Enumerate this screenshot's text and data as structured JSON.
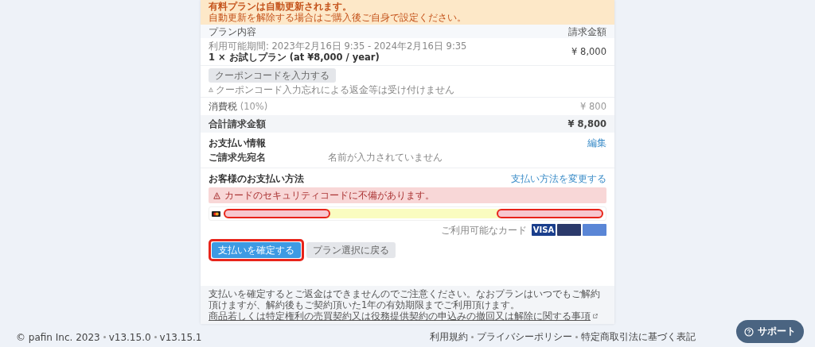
{
  "notice": {
    "title": "有料プランは自動更新されます。",
    "text": "自動更新を解除する場合はご購入後ご自身で設定ください。"
  },
  "plan_table": {
    "columns": [
      "プラン内容",
      "請求金額"
    ],
    "item": {
      "period": "利用可能期間: 2023年2月16日 9:35 - 2024年2月16日 9:35",
      "name": "1 × お試しプラン (at ¥8,000 / year)",
      "amount": "¥ 8,000"
    },
    "coupon_button": "クーポンコードを入力する",
    "coupon_note": "クーポンコード入力忘れによる返金等は受け付けません",
    "tax": {
      "label": "消費税",
      "rate": "(10%)",
      "amount": "¥ 800"
    },
    "total": {
      "label": "合計請求金額",
      "amount": "¥ 8,800"
    }
  },
  "payment_info": {
    "title": "お支払い情報",
    "edit_link": "編集",
    "billing_label": "ご請求先宛名",
    "billing_value": "名前が入力されていません"
  },
  "payment_method": {
    "title": "お客様のお支払い方法",
    "change_link": "支払い方法を変更する",
    "error": "カードのセキュリティコードに不備があります。",
    "accepted_label": "ご利用可能なカード",
    "accepted_cards": [
      {
        "label": "VISA",
        "color": "#1a3e8c"
      },
      {
        "color": "#2b3a6b"
      },
      {
        "color": "#5a86d6"
      }
    ]
  },
  "buttons": [
    {
      "label": "支払いを確定する",
      "kind": "primary"
    },
    {
      "label": "プラン選択に戻る",
      "kind": "secondary"
    }
  ],
  "notes": {
    "text": "支払いを確定するとご返金はできませんのでご注意ください。なおプランはいつでもご解約頂けますが、解約後もご契約頂いた1年の有効期限までご利用頂けます。",
    "link": "商品若しくは特定権利の売買契約又は役務提供契約の申込みの撤回又は解除に関する事項"
  },
  "footer": {
    "copyright": "© pafin Inc. 2023",
    "versions": [
      "v13.15.0",
      "v13.15.1"
    ],
    "links": [
      "利用規約",
      "プライバシーポリシー",
      "特定商取引法に基づく表記"
    ]
  },
  "support_button": "サポート"
}
